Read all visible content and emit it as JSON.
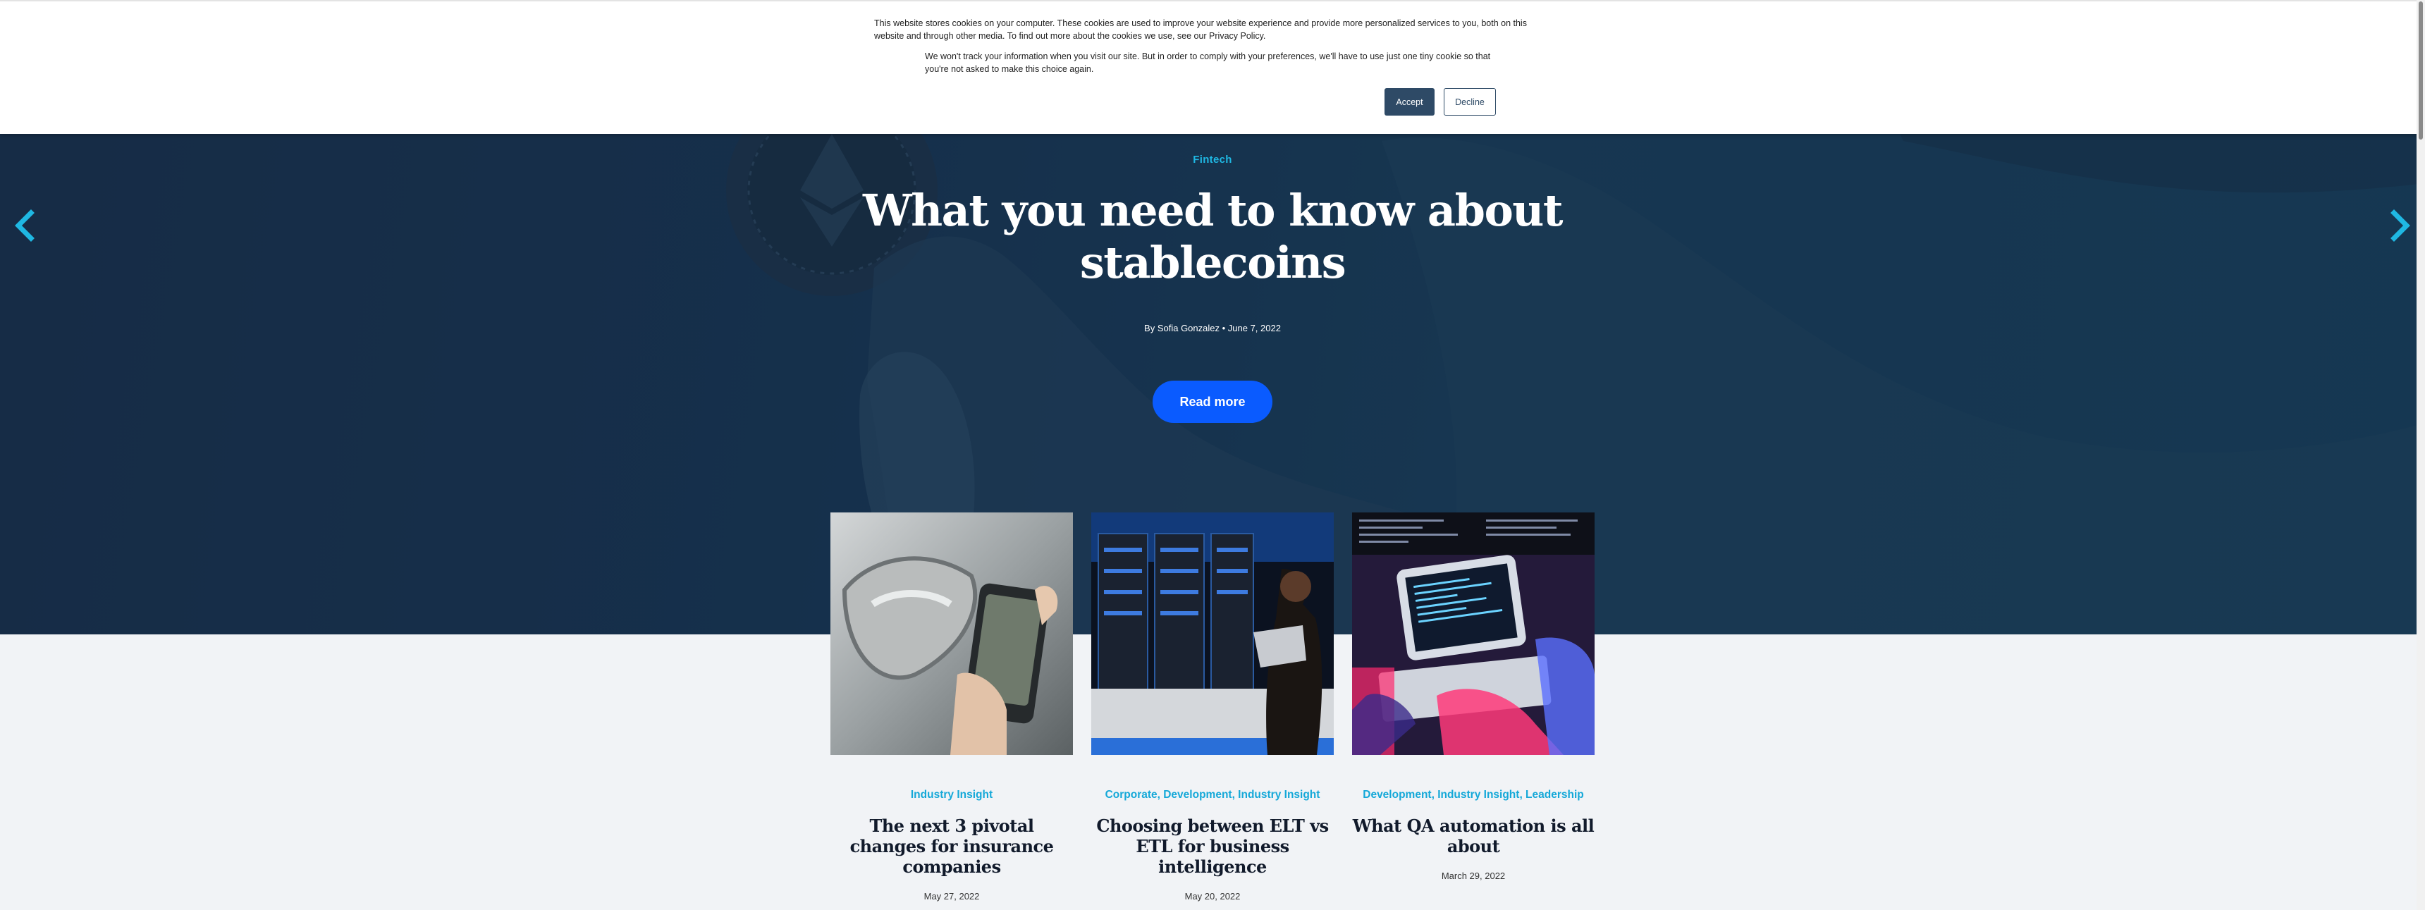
{
  "cookie_banner": {
    "text_primary": "This website stores cookies on your computer. These cookies are used to improve your website experience and provide more personalized services to you, both on this website and through other media. To find out more about the cookies we use, see our Privacy Policy.",
    "text_secondary": "We won't track your information when you visit our site. But in order to comply with your preferences, we'll have to use just one tiny cookie so that you're not asked to make this choice again.",
    "accept_label": "Accept",
    "decline_label": "Decline"
  },
  "hero": {
    "category": "Fintech",
    "title": "What you need to know about stablecoins",
    "byline": "By Sofia Gonzalez • June 7, 2022",
    "cta_label": "Read more",
    "prev_icon": "chevron-left-icon",
    "next_icon": "chevron-right-icon"
  },
  "cards": [
    {
      "categories": "Industry Insight",
      "title": "The next 3 pivotal changes for insurance companies",
      "date": "May 27, 2022"
    },
    {
      "categories": "Corporate, Development, Industry Insight",
      "title": "Choosing between ELT vs ETL for business intelligence",
      "date": "May 20, 2022"
    },
    {
      "categories": "Development, Industry Insight, Leadership",
      "title": "What QA automation is all about",
      "date": "March 29, 2022"
    }
  ],
  "colors": {
    "accent_cyan": "#1fb8e3",
    "cta_blue": "#0a5bff",
    "accept_bg": "#2e4a66",
    "page_bg": "#f1f3f6"
  }
}
